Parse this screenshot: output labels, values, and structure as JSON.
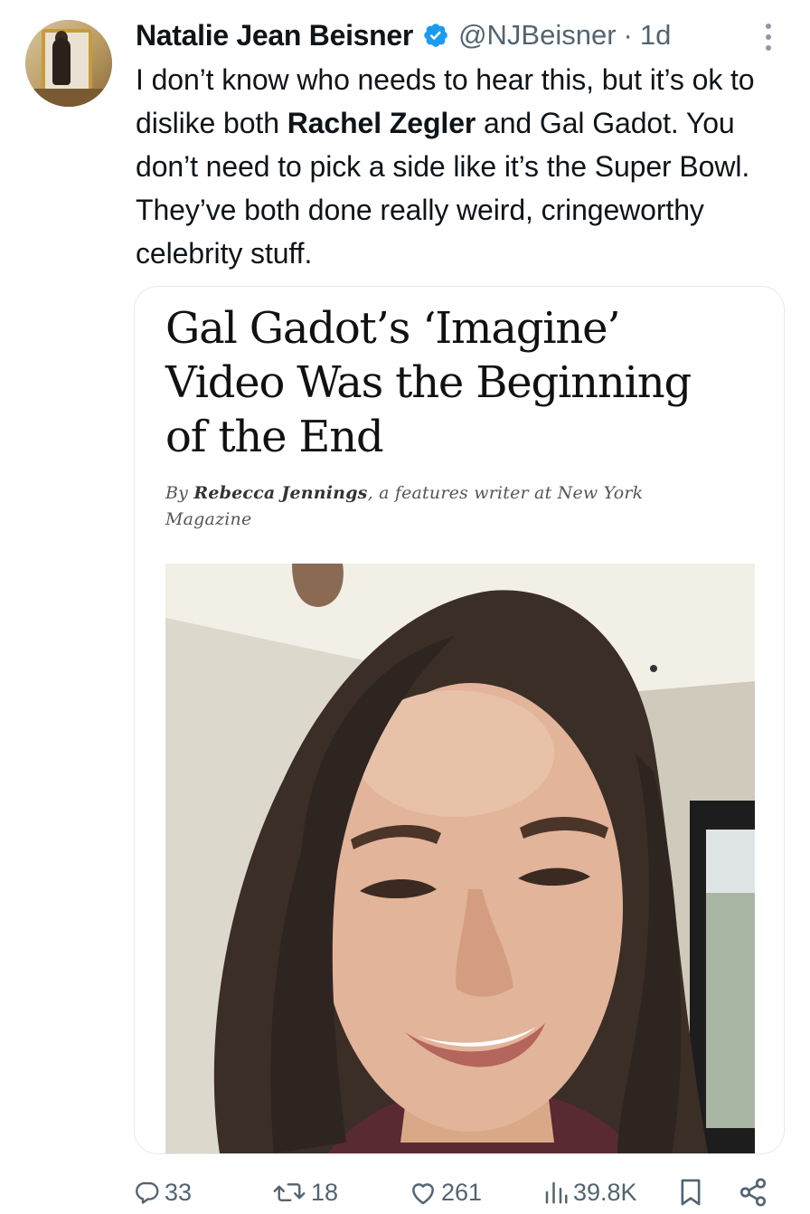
{
  "author": {
    "name": "Natalie Jean Beisner",
    "handle": "@NJBeisner",
    "separator": "·",
    "time": "1d",
    "verified": true,
    "avatar_icon": "avatar-photo"
  },
  "tweet": {
    "text_before": "I don’t know who needs to hear this, but it’s ok to dislike both ",
    "bold": "Rachel Zegler",
    "text_after": " and Gal Gadot. You don’t need to pick a side like it’s the Super Bowl. They’ve both done really weird, cringeworthy celebrity stuff."
  },
  "card": {
    "headline": "Gal Gadot’s ‘Imagine’\nVideo Was the Beginning\nof the End",
    "byline_prefix": "By ",
    "byline_author": "Rebecca Jennings",
    "byline_rest": ", a features writer at New York Magazine"
  },
  "actions": {
    "replies": "33",
    "reposts": "18",
    "likes": "261",
    "views": "39.8K"
  },
  "colors": {
    "text": "#0f1419",
    "secondary": "#536471",
    "verified": "#1d9bf0",
    "border": "#e6e9ec"
  }
}
